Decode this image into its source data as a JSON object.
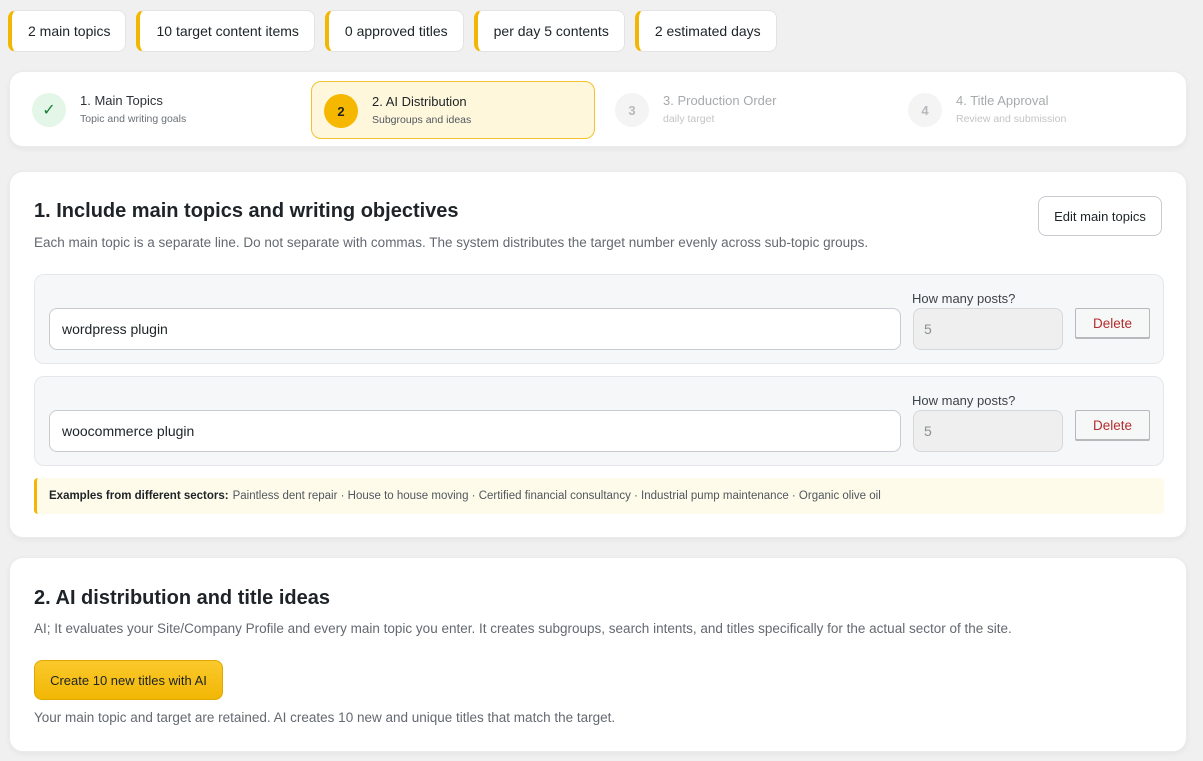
{
  "stats": [
    "2 main topics",
    "10 target content items",
    "0 approved titles",
    "per day 5 contents",
    "2 estimated days"
  ],
  "steps": [
    {
      "num": "✓",
      "title": "1. Main Topics",
      "sub": "Topic and writing goals",
      "state": "done"
    },
    {
      "num": "2",
      "title": "2. AI Distribution",
      "sub": "Subgroups and ideas",
      "state": "active"
    },
    {
      "num": "3",
      "title": "3. Production Order",
      "sub": "daily target",
      "state": "pending"
    },
    {
      "num": "4",
      "title": "4. Title Approval",
      "sub": "Review and submission",
      "state": "pending"
    }
  ],
  "section1": {
    "title": "1. Include main topics and writing objectives",
    "description": "Each main topic is a separate line. Do not separate with commas. The system distributes the target number evenly across sub-topic groups.",
    "edit_label": "Edit main topics",
    "count_label": "How many posts?",
    "delete_label": "Delete",
    "topics": [
      {
        "value": "wordpress plugin",
        "count": "5"
      },
      {
        "value": "woocommerce plugin",
        "count": "5"
      }
    ],
    "examples_label": "Examples from different sectors:",
    "examples_text": "Paintless dent repair · House to house moving · Certified financial consultancy · Industrial pump maintenance · Organic olive oil"
  },
  "section2": {
    "title": "2. AI distribution and title ideas",
    "description": "AI; It evaluates your Site/Company Profile and every main topic you enter. It creates subgroups, search intents, and titles specifically for the actual sector of the site.",
    "button_label": "Create 10 new titles with AI",
    "note": "Your main topic and target are retained. AI creates 10 new and unique titles that match the target."
  },
  "colors": {
    "accent": "#f2b705",
    "danger": "#b32d2e",
    "success": "#1a7f37"
  }
}
